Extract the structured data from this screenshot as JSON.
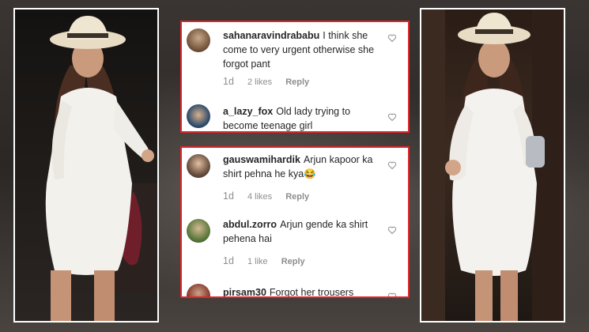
{
  "comments_top": [
    {
      "username": "sahanaravindrababu",
      "text": "I think she come to very urgent otherwise she forgot pant",
      "time": "1d",
      "likes": "2 likes",
      "reply": "Reply"
    },
    {
      "username": "a_lazy_fox",
      "text": "Old lady trying to become teenage girl"
    }
  ],
  "comments_bottom": [
    {
      "username": "gauswamihardik",
      "text": "Arjun kapoor ka shirt pehna he kya😂",
      "time": "1d",
      "likes": "4 likes",
      "reply": "Reply"
    },
    {
      "username": "abdul.zorro",
      "text": "Arjun gende ka shirt pehena hai",
      "time": "1d",
      "likes": "1 like",
      "reply": "Reply"
    },
    {
      "username": "pirsam30",
      "text": "Forgot her trousers"
    }
  ],
  "colors": {
    "border_red": "#e0252a",
    "frame_white": "#ffffff",
    "text": "#262626",
    "muted": "#8e8e8e"
  },
  "icons": [
    "heart-icon",
    "avatar"
  ]
}
